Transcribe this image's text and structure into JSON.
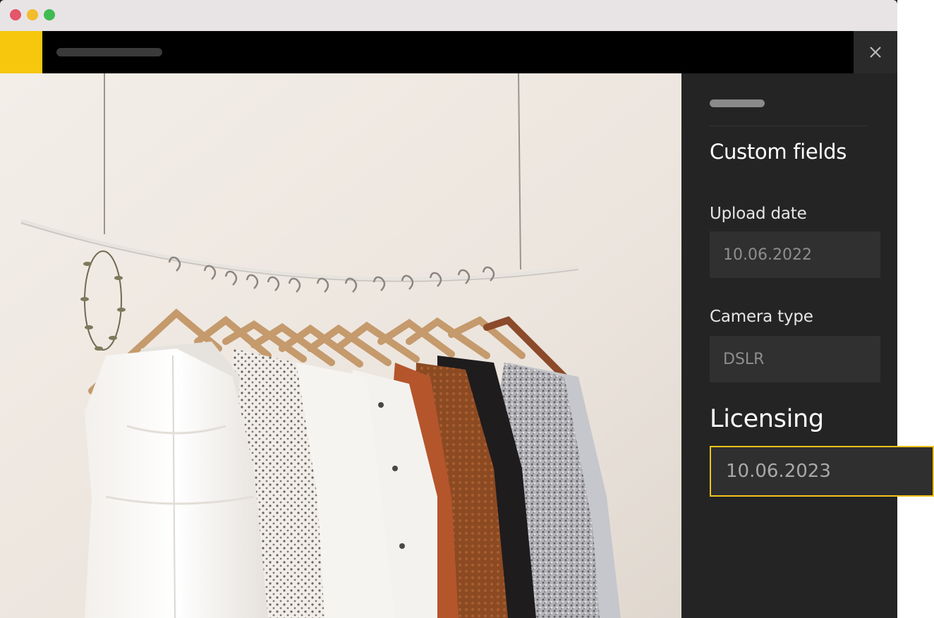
{
  "window": {
    "controls": [
      "close",
      "minimize",
      "maximize"
    ]
  },
  "header": {
    "brand_color": "#f6c70c",
    "close_icon": "close-icon"
  },
  "colors": {
    "panel_bg": "#242424",
    "accent": "#f2c21b",
    "input_bg": "#303030"
  },
  "panel": {
    "heading": "Custom fields",
    "fields": [
      {
        "label": "Upload date",
        "value": "10.06.2022"
      },
      {
        "label": "Camera type",
        "value": "DSLR"
      }
    ],
    "licensing": {
      "heading": "Licensing",
      "value": "10.06.2023"
    }
  }
}
